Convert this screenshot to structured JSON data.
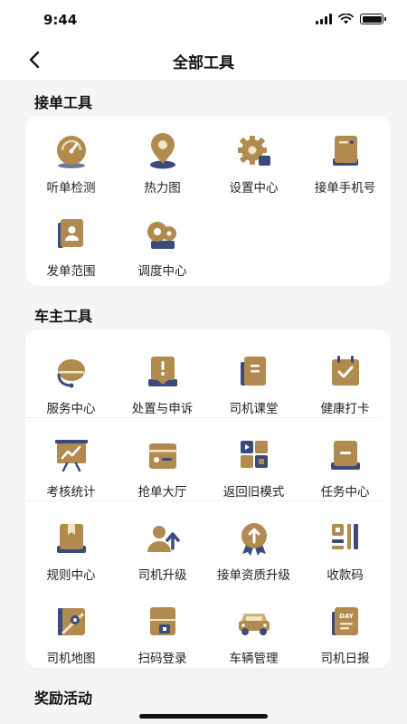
{
  "status": {
    "time": "9:44"
  },
  "nav": {
    "title": "全部工具"
  },
  "colors": {
    "gold": "#b08a4e",
    "gold_light": "#cfae74",
    "navy": "#3a4a7a"
  },
  "sections": [
    {
      "title": "接单工具",
      "tools": [
        {
          "label": "听单检测",
          "icon": "gauge-icon"
        },
        {
          "label": "热力图",
          "icon": "map-pin-icon"
        },
        {
          "label": "设置中心",
          "icon": "gear-icon"
        },
        {
          "label": "接单手机号",
          "icon": "phone-icon"
        },
        {
          "label": "发单范围",
          "icon": "user-card-icon"
        },
        {
          "label": "调度中心",
          "icon": "dispatch-icon"
        }
      ]
    },
    {
      "title": "车主工具",
      "tools": [
        {
          "label": "服务中心",
          "icon": "headset-icon"
        },
        {
          "label": "处置与申诉",
          "icon": "alert-icon"
        },
        {
          "label": "司机课堂",
          "icon": "book-icon"
        },
        {
          "label": "健康打卡",
          "icon": "calendar-check-icon"
        },
        {
          "label": "考核统计",
          "icon": "chart-board-icon"
        },
        {
          "label": "抢单大厅",
          "icon": "hall-icon"
        },
        {
          "label": "返回旧模式",
          "icon": "grid-icon"
        },
        {
          "label": "任务中心",
          "icon": "task-icon"
        },
        {
          "label": "规则中心",
          "icon": "rule-book-icon"
        },
        {
          "label": "司机升级",
          "icon": "upgrade-icon"
        },
        {
          "label": "接单资质升级",
          "icon": "badge-upgrade-icon"
        },
        {
          "label": "收款码",
          "icon": "qr-code-icon"
        },
        {
          "label": "司机地图",
          "icon": "map-icon"
        },
        {
          "label": "扫码登录",
          "icon": "scan-login-icon"
        },
        {
          "label": "车辆管理",
          "icon": "car-icon"
        },
        {
          "label": "司机日报",
          "icon": "day-report-icon"
        }
      ]
    },
    {
      "title": "奖励活动",
      "tools": []
    }
  ],
  "icon_texts": {
    "day": "DAY"
  }
}
